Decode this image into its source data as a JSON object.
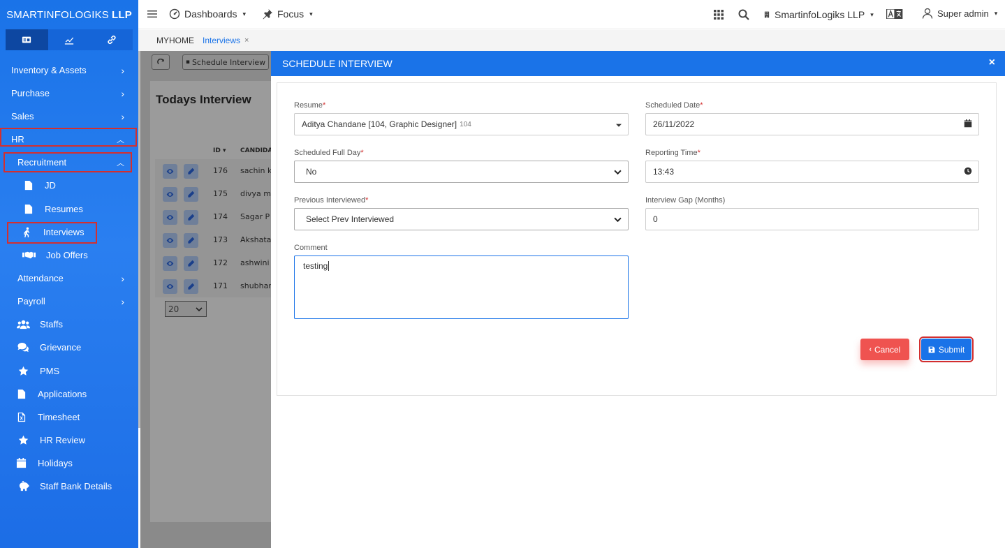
{
  "brand": {
    "name_light": "SMARTINFOLOGIKS",
    "name_bold": "LLP"
  },
  "sidebar": {
    "tabs": [
      {
        "icon": "dashboard-card-icon"
      },
      {
        "icon": "chart-icon"
      },
      {
        "icon": "link-icon"
      }
    ],
    "items": [
      {
        "label": "Inventory & Assets",
        "chevron": "›"
      },
      {
        "label": "Purchase",
        "chevron": "›"
      },
      {
        "label": "Sales",
        "chevron": "›"
      },
      {
        "label": "HR",
        "chevron": "︿"
      },
      {
        "label": "Recruitment",
        "chevron": "︿"
      },
      {
        "label": "JD"
      },
      {
        "label": "Resumes"
      },
      {
        "label": "Interviews"
      },
      {
        "label": "Job Offers"
      },
      {
        "label": "Attendance",
        "chevron": "›"
      },
      {
        "label": "Payroll",
        "chevron": "›"
      },
      {
        "label": "Staffs"
      },
      {
        "label": "Grievance"
      },
      {
        "label": "PMS"
      },
      {
        "label": "Applications"
      },
      {
        "label": "Timesheet"
      },
      {
        "label": "HR Review"
      },
      {
        "label": "Holidays"
      },
      {
        "label": "Staff Bank Details"
      }
    ]
  },
  "topbar": {
    "dashboards": "Dashboards",
    "focus": "Focus",
    "company": "SmartinfoLogiks LLP",
    "user": "Super admin",
    "caret": "▾"
  },
  "breadcrumb": {
    "home": "MYHOME",
    "current": "Interviews",
    "close": "×"
  },
  "background": {
    "schedule_button": "Schedule Interview",
    "title": "Todays Interview",
    "col_id": "ID",
    "col_id_sort": "▾",
    "col_candidate": "CANDIDA",
    "rows": [
      {
        "id": "176",
        "name": "sachin k"
      },
      {
        "id": "175",
        "name": "divya m"
      },
      {
        "id": "174",
        "name": "Sagar P"
      },
      {
        "id": "173",
        "name": "Akshata"
      },
      {
        "id": "172",
        "name": "ashwini"
      },
      {
        "id": "171",
        "name": "shubham"
      }
    ],
    "page_size": "20"
  },
  "modal": {
    "title": "SCHEDULE INTERVIEW",
    "close": "×",
    "resume": {
      "label": "Resume",
      "req": "*",
      "value": "Aditya Chandane [104, Graphic Designer]",
      "extra": "104"
    },
    "scheduled_date": {
      "label": "Scheduled Date",
      "req": "*",
      "value": "26/11/2022"
    },
    "full_day": {
      "label": "Scheduled Full Day",
      "req": "*",
      "value": "No"
    },
    "reporting_time": {
      "label": "Reporting Time",
      "req": "*",
      "value": "13:43"
    },
    "prev_interviewed": {
      "label": "Previous Interviewed",
      "req": "*",
      "value": "Select Prev Interviewed"
    },
    "interview_gap": {
      "label": "Interview Gap (Months)",
      "value": "0"
    },
    "comment": {
      "label": "Comment",
      "value": "testing"
    },
    "cancel": "Cancel",
    "submit": "Submit"
  },
  "colors": {
    "primary": "#1a73e8",
    "danger": "#ef5350",
    "highlight": "#d32f2f"
  }
}
